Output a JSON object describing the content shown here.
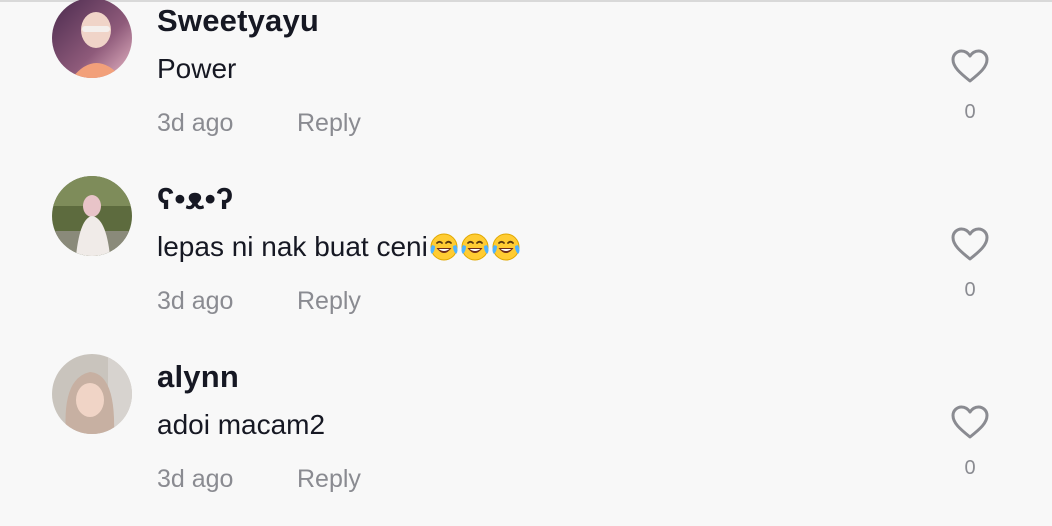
{
  "comments": [
    {
      "username": "Sweetyayu",
      "text": "Power",
      "time": "3d ago",
      "reply_label": "Reply",
      "like_count": "0",
      "avatar_colors": [
        "#6a3a6a",
        "#d9a0b0"
      ]
    },
    {
      "username": "ʕ•ᴥ•ʔ",
      "text": "lepas ni nak buat ceni",
      "emojis": [
        "face-with-tears-of-joy-emoji",
        "face-with-tears-of-joy-emoji",
        "face-with-tears-of-joy-emoji"
      ],
      "time": "3d ago",
      "reply_label": "Reply",
      "like_count": "0",
      "avatar_colors": [
        "#6b7a4a",
        "#e6e0dc"
      ]
    },
    {
      "username": "alynn",
      "text": "adoi macam2",
      "time": "3d ago",
      "reply_label": "Reply",
      "like_count": "0",
      "avatar_colors": [
        "#b0a8a0",
        "#d8c0b8"
      ]
    }
  ],
  "colors": {
    "background": "#f8f8f8",
    "primary_text": "#161823",
    "secondary_text": "#8a8b91",
    "heart_stroke": "#8a8b91"
  }
}
